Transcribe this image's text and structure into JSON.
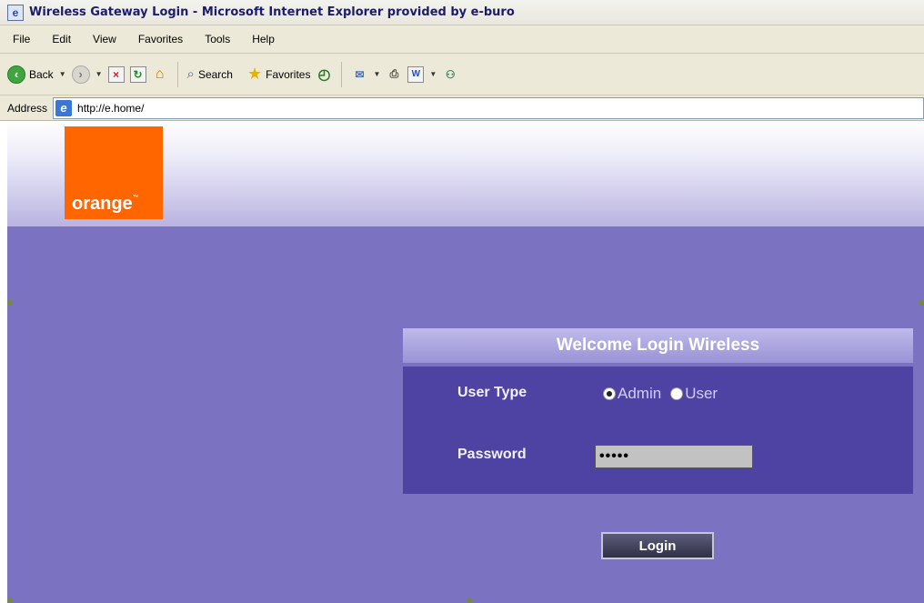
{
  "window": {
    "title": "Wireless Gateway Login - Microsoft Internet Explorer provided by e-buro"
  },
  "menubar": {
    "items": [
      "File",
      "Edit",
      "View",
      "Favorites",
      "Tools",
      "Help"
    ]
  },
  "toolbar": {
    "back_label": "Back",
    "search_label": "Search",
    "favorites_label": "Favorites"
  },
  "address": {
    "label": "Address",
    "url": "http://e.home/"
  },
  "page": {
    "logo_text": "orange",
    "logo_tm": "™",
    "brand_color": "#ff6600",
    "background_color": "#7b72c2",
    "login_title": "Welcome Login Wireless",
    "user_type_label": "User Type",
    "radio_options": [
      {
        "label": "Admin",
        "checked": true
      },
      {
        "label": "User",
        "checked": false
      }
    ],
    "password_label": "Password",
    "password_masked": "•••••",
    "login_button": "Login"
  }
}
